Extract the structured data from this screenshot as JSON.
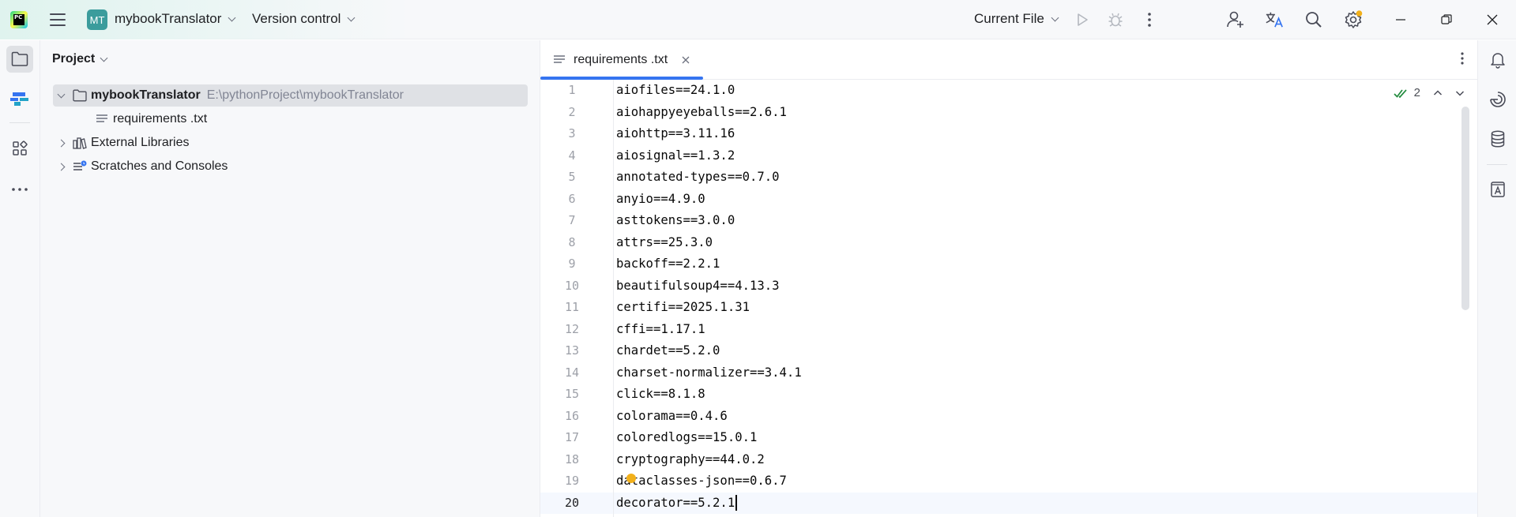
{
  "titlebar": {
    "project_badge": "MT",
    "project_name": "mybookTranslator",
    "vcs_label": "Version control",
    "run_config": "Current File"
  },
  "project_panel": {
    "title": "Project",
    "tree": {
      "root_name": "mybookTranslator",
      "root_path": "E:\\pythonProject\\mybookTranslator",
      "file": "requirements .txt",
      "external_libraries": "External Libraries",
      "scratches": "Scratches and Consoles"
    }
  },
  "editor": {
    "tab_label": "requirements .txt",
    "inspection_count": "2",
    "current_line": 20,
    "lines": [
      {
        "num": "1",
        "text": "aiofiles==24.1.0"
      },
      {
        "num": "2",
        "text": "aiohappyeyeballs==2.6.1"
      },
      {
        "num": "3",
        "text": "aiohttp==3.11.16"
      },
      {
        "num": "4",
        "text": "aiosignal==1.3.2"
      },
      {
        "num": "5",
        "text": "annotated-types==0.7.0"
      },
      {
        "num": "6",
        "text": "anyio==4.9.0"
      },
      {
        "num": "7",
        "text": "asttokens==3.0.0"
      },
      {
        "num": "8",
        "text": "attrs==25.3.0"
      },
      {
        "num": "9",
        "text": "backoff==2.2.1"
      },
      {
        "num": "10",
        "text": "beautifulsoup4==4.13.3"
      },
      {
        "num": "11",
        "text": "certifi==2025.1.31"
      },
      {
        "num": "12",
        "text": "cffi==1.17.1"
      },
      {
        "num": "13",
        "text": "chardet==5.2.0"
      },
      {
        "num": "14",
        "text": "charset-normalizer==3.4.1"
      },
      {
        "num": "15",
        "text": "click==8.1.8"
      },
      {
        "num": "16",
        "text": "colorama==0.4.6"
      },
      {
        "num": "17",
        "text": "coloredlogs==15.0.1"
      },
      {
        "num": "18",
        "text": "cryptography==44.0.2"
      },
      {
        "num": "19",
        "text": "dataclasses-json==0.6.7"
      },
      {
        "num": "20",
        "text": "decorator==5.2.1"
      }
    ]
  },
  "colors": {
    "accent": "#3574f0",
    "project_badge": "#3b9c9c",
    "notification_dot": "#f2b01a",
    "inspection_ok": "#208a3c"
  },
  "icons": {
    "app_logo": "pycharm-logo-icon",
    "main_menu": "hamburger-menu-icon",
    "run": "play-icon",
    "debug": "bug-icon",
    "more": "vertical-ellipsis-icon",
    "collab": "add-user-icon",
    "translate": "translate-icon",
    "search": "search-icon",
    "settings": "gear-icon"
  }
}
